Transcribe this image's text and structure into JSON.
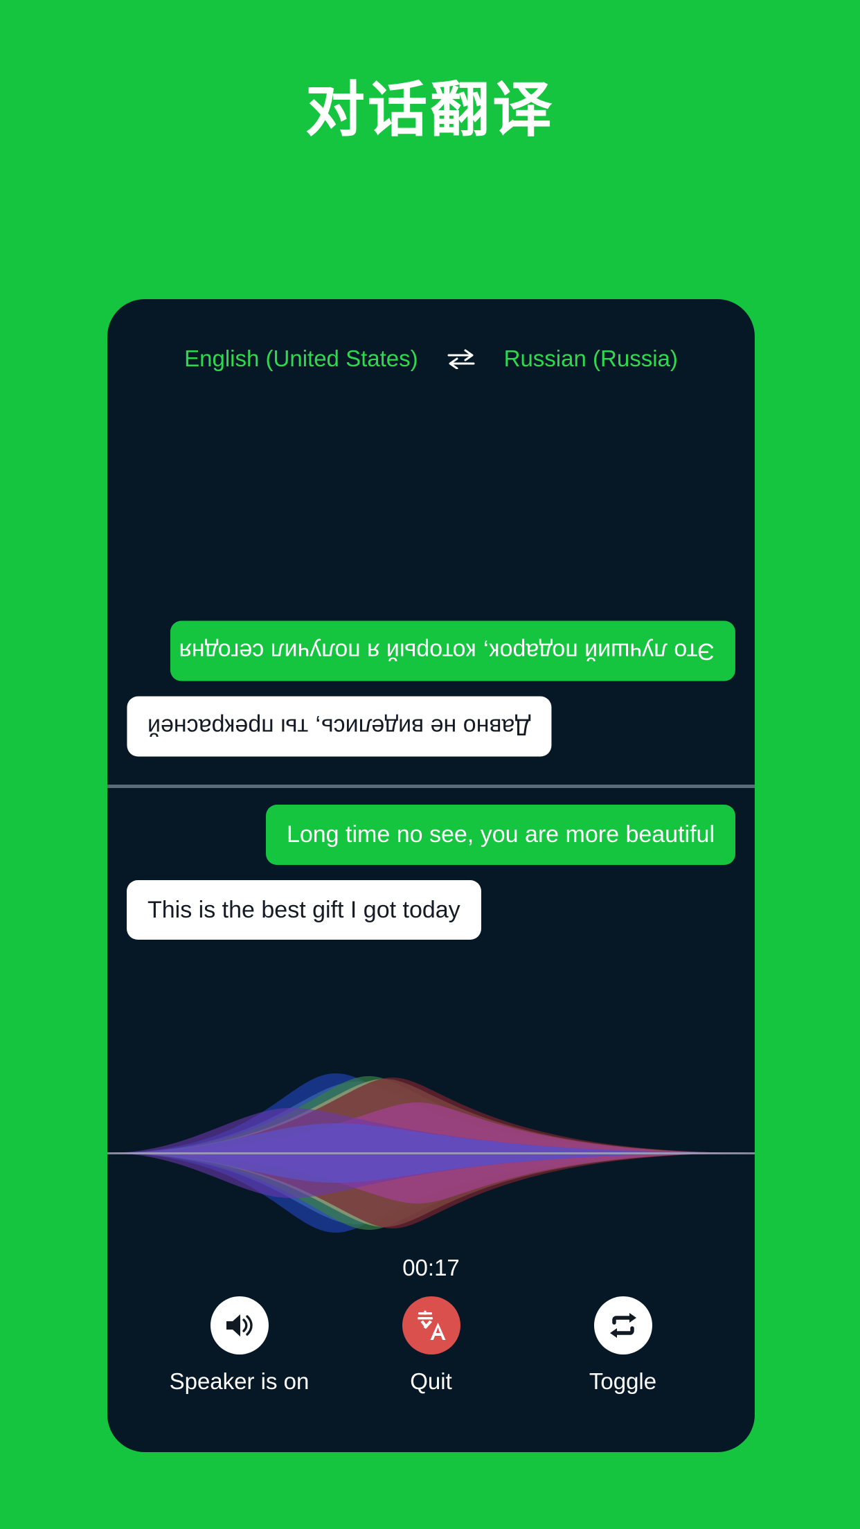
{
  "header": {
    "title": "对话翻译"
  },
  "colors": {
    "background_green": "#15c43f",
    "panel_dark": "#061726",
    "accent_green_text": "#2fd94f",
    "bubble_green": "#15c43f",
    "bubble_white": "#ffffff",
    "quit_red": "#d9504c",
    "divider": "#5a6b78"
  },
  "language_bar": {
    "source_language": "English (United States)",
    "swap_icon": "swap-arrows-icon",
    "target_language": "Russian (Russia)"
  },
  "conversation": {
    "remote_pane": {
      "rotated": true,
      "messages": [
        {
          "text": "Это лучший подарок, который я получил сегодня",
          "align": "right",
          "style": "green"
        },
        {
          "text": "Давно не виделись, ты прекрасней",
          "align": "left",
          "style": "white"
        }
      ]
    },
    "local_pane": {
      "rotated": false,
      "messages": [
        {
          "text": "Long time no see, you are more beautiful",
          "align": "right",
          "style": "green"
        },
        {
          "text": "This is the best gift I got today",
          "align": "left",
          "style": "white"
        }
      ]
    }
  },
  "waveform": {
    "icon": "audio-waveform-visualizer",
    "lobe_colors": [
      "#1f3fa8",
      "#4a7fd0",
      "#3f8f4a",
      "#c9bf85",
      "#8a2630",
      "#c049a8",
      "#7b3fc4",
      "#6a5ce8"
    ]
  },
  "timer": {
    "value": "00:17"
  },
  "controls": [
    {
      "icon": "speaker-on-icon",
      "label": "Speaker is on",
      "style": "light"
    },
    {
      "icon": "translate-icon",
      "label": "Quit",
      "style": "danger"
    },
    {
      "icon": "toggle-repeat-icon",
      "label": "Toggle",
      "style": "light"
    }
  ]
}
